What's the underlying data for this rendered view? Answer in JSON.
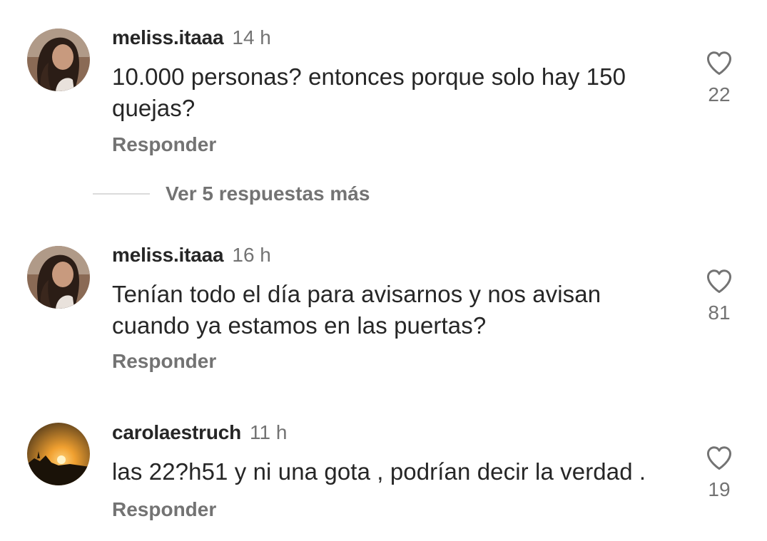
{
  "comments": [
    {
      "username": "meliss.itaaa",
      "time": "14 h",
      "text": "10.000 personas? entonces porque solo hay 150 quejas?",
      "reply_label": "Responder",
      "likes": "22",
      "avatar": "woman-curly-hair"
    },
    {
      "username": "meliss.itaaa",
      "time": "16 h",
      "text": "Tenían todo el día para avisarnos y nos avisan cuando ya estamos en las puertas?",
      "reply_label": "Responder",
      "likes": "81",
      "avatar": "woman-curly-hair"
    },
    {
      "username": "carolaestruch",
      "time": "11 h",
      "text": "las 22?h51 y ni una gota , podrían decir la verdad .",
      "reply_label": "Responder",
      "likes": "19",
      "avatar": "sunset"
    }
  ],
  "view_more_replies": "Ver 5 respuestas más",
  "icons": {
    "like": "heart-outline-icon"
  },
  "colors": {
    "primary_text": "#262626",
    "secondary_text": "#737373",
    "divider": "#dbdbdb"
  }
}
